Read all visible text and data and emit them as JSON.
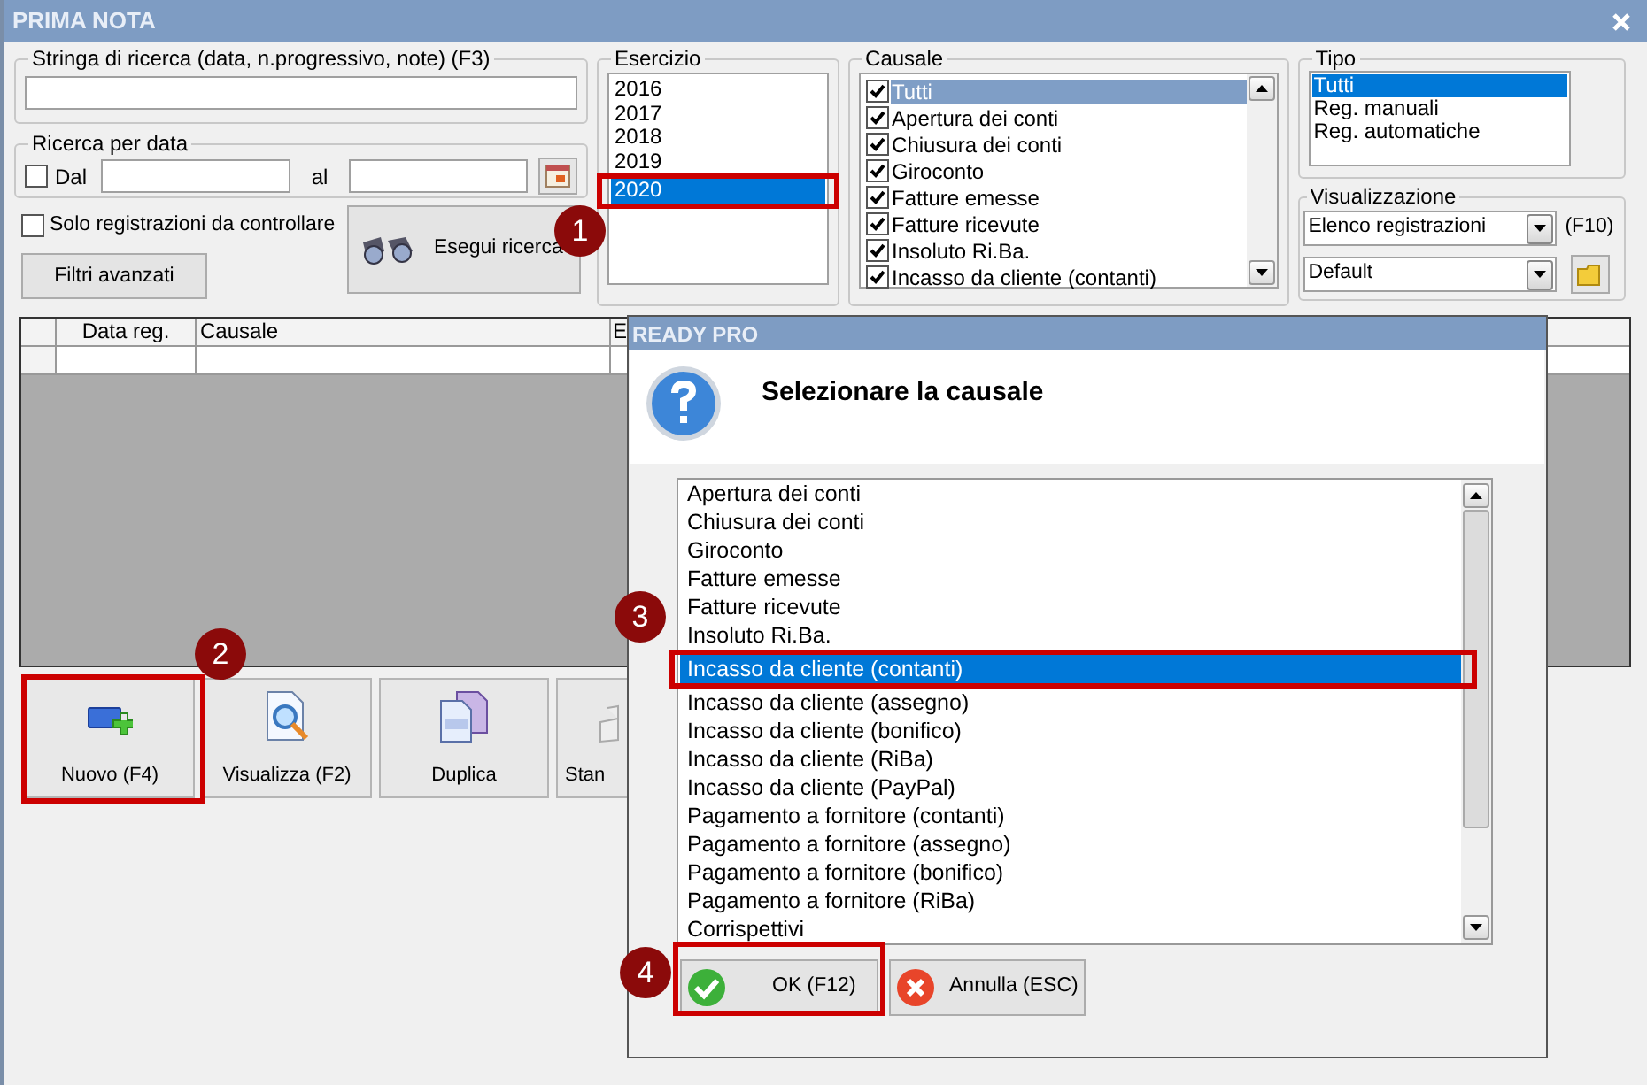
{
  "window": {
    "title": "PRIMA NOTA"
  },
  "search": {
    "label": "Stringa di ricerca (data, n.progressivo, note) (F3)"
  },
  "date_search": {
    "label": "Ricerca per data",
    "from_label": "Dal",
    "from_checked": false,
    "to_label": "al"
  },
  "only_check": {
    "label": "Solo registrazioni da controllare",
    "checked": false
  },
  "advanced_filters": "Filtri avanzati",
  "run_search": "Esegui ricerca",
  "esercizio": {
    "label": "Esercizio",
    "items": [
      {
        "text": "2016",
        "selected": false
      },
      {
        "text": "2017",
        "selected": false
      },
      {
        "text": "2018",
        "selected": false
      },
      {
        "text": "2019",
        "selected": false
      },
      {
        "text": "2020",
        "selected": true
      }
    ]
  },
  "causale": {
    "label": "Causale",
    "items": [
      {
        "text": "Tutti",
        "checked": true,
        "selected": true
      },
      {
        "text": "Apertura dei conti",
        "checked": true,
        "selected": false
      },
      {
        "text": "Chiusura dei conti",
        "checked": true,
        "selected": false
      },
      {
        "text": "Giroconto",
        "checked": true,
        "selected": false
      },
      {
        "text": "Fatture emesse",
        "checked": true,
        "selected": false
      },
      {
        "text": "Fatture ricevute",
        "checked": true,
        "selected": false
      },
      {
        "text": "Insoluto Ri.Ba.",
        "checked": true,
        "selected": false
      },
      {
        "text": "Incasso da cliente (contanti)",
        "checked": true,
        "selected": false
      }
    ]
  },
  "tipo": {
    "label": "Tipo",
    "items": [
      {
        "text": "Tutti",
        "selected": true
      },
      {
        "text": "Reg. manuali",
        "selected": false
      },
      {
        "text": "Reg. automatiche",
        "selected": false
      }
    ]
  },
  "visualizzazione": {
    "label": "Visualizzazione",
    "view": "Elenco registrazioni",
    "shortcut": "(F10)",
    "layout": "Default"
  },
  "grid": {
    "columns": [
      "Data reg.",
      "Causale",
      "E"
    ]
  },
  "actions": [
    {
      "label": "Nuovo (F4)",
      "kind": "new"
    },
    {
      "label": "Visualizza (F2)",
      "kind": "view"
    },
    {
      "label": "Duplica",
      "kind": "copy"
    },
    {
      "label": "Stan",
      "kind": "print"
    }
  ],
  "dialog": {
    "title": "READY PRO",
    "prompt": "Selezionare la causale",
    "items": [
      {
        "text": "Apertura dei conti",
        "selected": false
      },
      {
        "text": "Chiusura dei conti",
        "selected": false
      },
      {
        "text": "Giroconto",
        "selected": false
      },
      {
        "text": "Fatture emesse",
        "selected": false
      },
      {
        "text": "Fatture ricevute",
        "selected": false
      },
      {
        "text": "Insoluto Ri.Ba.",
        "selected": false
      },
      {
        "text": "Incasso da cliente (contanti)",
        "selected": true
      },
      {
        "text": "Incasso da cliente (assegno)",
        "selected": false
      },
      {
        "text": "Incasso da cliente (bonifico)",
        "selected": false
      },
      {
        "text": "Incasso da cliente (RiBa)",
        "selected": false
      },
      {
        "text": "Incasso da cliente (PayPal)",
        "selected": false
      },
      {
        "text": "Pagamento a fornitore (contanti)",
        "selected": false
      },
      {
        "text": "Pagamento a fornitore (assegno)",
        "selected": false
      },
      {
        "text": "Pagamento a fornitore (bonifico)",
        "selected": false
      },
      {
        "text": "Pagamento a fornitore (RiBa)",
        "selected": false
      },
      {
        "text": "Corrispettivi",
        "selected": false
      }
    ],
    "ok": "OK (F12)",
    "cancel": "Annulla (ESC)"
  },
  "callouts": [
    "1",
    "2",
    "3",
    "4"
  ]
}
